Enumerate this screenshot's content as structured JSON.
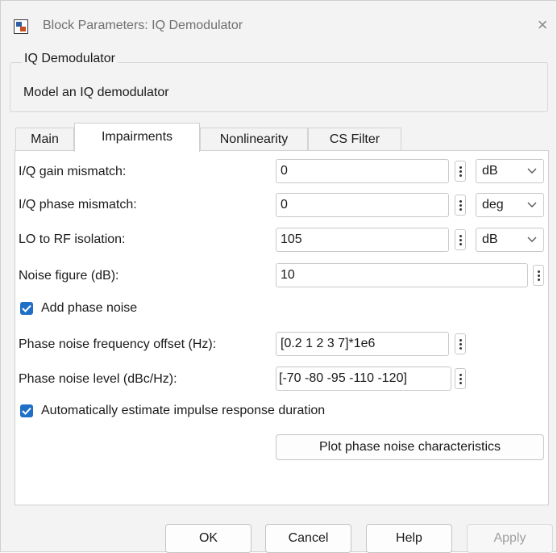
{
  "window": {
    "title": "Block Parameters: IQ Demodulator",
    "close_glyph": "×"
  },
  "group": {
    "legend": "IQ Demodulator",
    "description": "Model an IQ demodulator"
  },
  "tabs": [
    {
      "label": "Main"
    },
    {
      "label": "Impairments"
    },
    {
      "label": "Nonlinearity"
    },
    {
      "label": "CS Filter"
    }
  ],
  "active_tab": "Impairments",
  "params": {
    "gain_mismatch": {
      "label": "I/Q gain mismatch:",
      "value": "0",
      "unit": "dB"
    },
    "phase_mismatch": {
      "label": "I/Q phase mismatch:",
      "value": "0",
      "unit": "deg"
    },
    "lo_rf_isolation": {
      "label": "LO to RF isolation:",
      "value": "105",
      "unit": "dB"
    },
    "noise_figure": {
      "label": "Noise figure (dB):",
      "value": "10"
    },
    "add_phase_noise": {
      "label": "Add phase noise",
      "checked": true
    },
    "phase_noise_freq": {
      "label": "Phase noise frequency offset (Hz):",
      "value": "[0.2 1 2 3 7]*1e6"
    },
    "phase_noise_level": {
      "label": "Phase noise level (dBc/Hz):",
      "value": "[-70 -80 -95 -110 -120]"
    },
    "auto_estimate": {
      "label": "Automatically estimate impulse response duration",
      "checked": true
    },
    "plot_button": "Plot phase noise characteristics"
  },
  "buttons": {
    "ok": "OK",
    "cancel": "Cancel",
    "help": "Help",
    "apply": "Apply"
  },
  "colors": {
    "accent": "#1f6fc6",
    "window_bg": "#f3f3f3",
    "panel_bg": "#ffffff"
  },
  "icons": [
    "simulink-block-icon",
    "close-icon",
    "kebab-menu-icon",
    "chevron-down-icon",
    "checkmark-icon"
  ]
}
